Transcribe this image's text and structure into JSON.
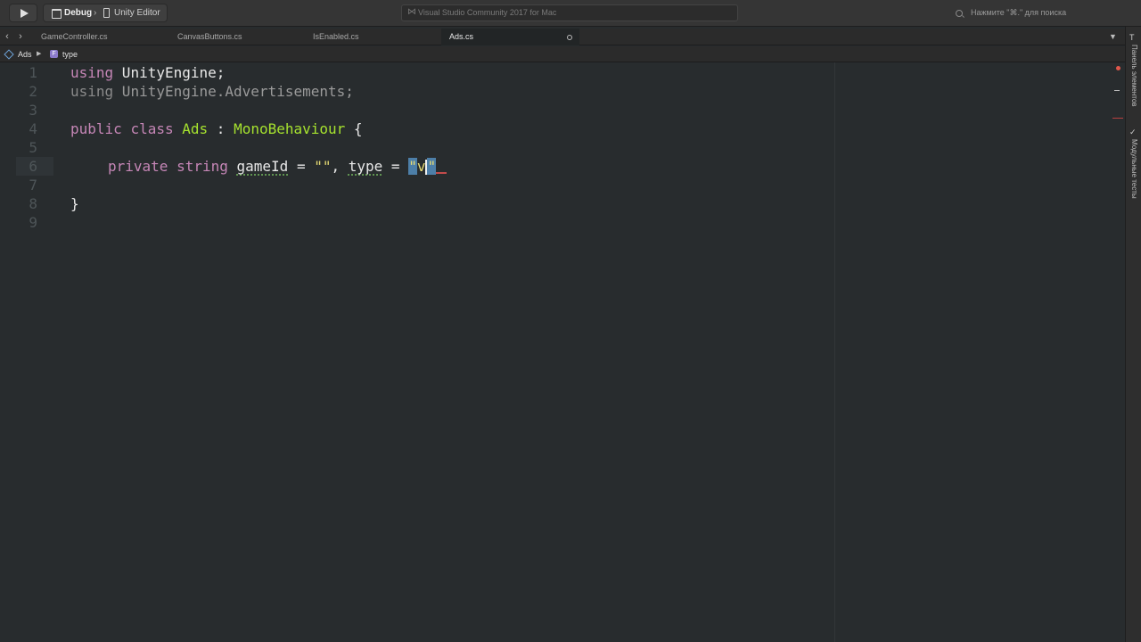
{
  "toolbar": {
    "configuration": "Debug",
    "target": "Unity Editor",
    "status": "Visual Studio Community 2017 for Mac",
    "search_placeholder": "Нажмите \"⌘.\" для поиска"
  },
  "tabs": [
    {
      "label": "GameController.cs",
      "active": false
    },
    {
      "label": "CanvasButtons.cs",
      "active": false
    },
    {
      "label": "IsEnabled.cs",
      "active": false
    },
    {
      "label": "Ads.cs",
      "active": true
    }
  ],
  "breadcrumb": {
    "class_name": "Ads",
    "member_name": "type",
    "field_icon_letter": "F"
  },
  "editor": {
    "line_numbers": [
      "1",
      "2",
      "3",
      "4",
      "5",
      "6",
      "7",
      "8",
      "9"
    ],
    "current_line": 6,
    "lines": {
      "l1": {
        "kw": "using",
        "rest": " UnityEngine;"
      },
      "l2": {
        "kw": "using",
        "rest": " UnityEngine.Advertisements;"
      },
      "l4": {
        "kw1": "public",
        "kw2": "class",
        "name": "Ads",
        "colon": " : ",
        "base": "MonoBehaviour",
        "brace": " {"
      },
      "l6": {
        "kw1": "private",
        "kw2": "string",
        "id1": "gameId",
        "eq1": " = ",
        "str1": "\"\"",
        "comma": ", ",
        "id2": "type",
        "eq2": " = ",
        "str2_open": "\"",
        "str2_text": "v",
        "str2_close": "\""
      },
      "l8": {
        "brace": "}"
      }
    }
  },
  "dock": {
    "toolbox": "Панель элементов",
    "unit_tests": "Модульные тесты"
  },
  "colors": {
    "keyword": "#c586b6",
    "type": "#a6e22e",
    "string": "#e6db74",
    "background": "#282c2e"
  }
}
